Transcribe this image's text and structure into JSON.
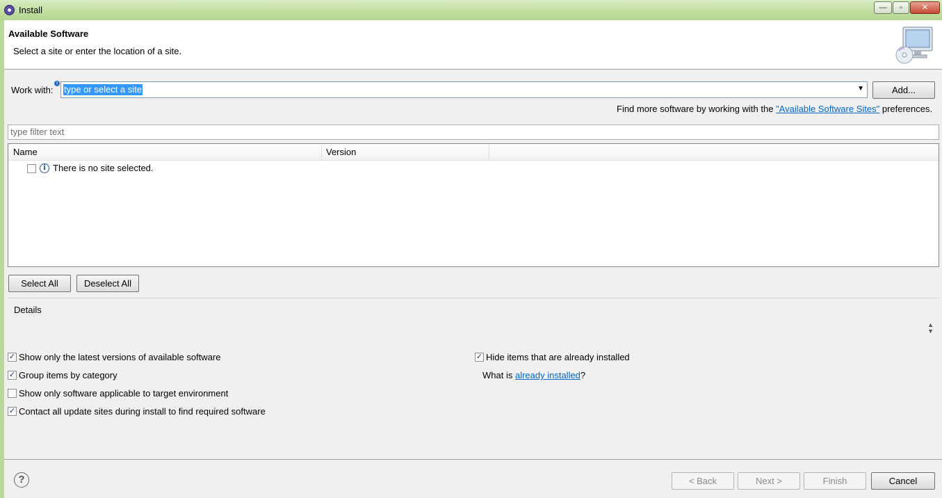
{
  "window": {
    "title": "Install",
    "controls": [
      "minimize",
      "maximize",
      "close"
    ]
  },
  "header": {
    "title": "Available Software",
    "description": "Select a site or enter the location of a site."
  },
  "work_with": {
    "label": "Work with:",
    "value": "type or select a site",
    "add_button": "Add...",
    "find_more_prefix": "Find more software by working with the ",
    "find_more_link": "\"Available Software Sites\"",
    "find_more_suffix": " preferences."
  },
  "filter": {
    "placeholder": "type filter text"
  },
  "table": {
    "columns": [
      "Name",
      "Version"
    ],
    "rows": [
      {
        "checked": false,
        "icon": "info-icon",
        "text": "There is no site selected."
      }
    ]
  },
  "buttons": {
    "select_all": "Select All",
    "deselect_all": "Deselect All",
    "back": "< Back",
    "next": "Next >",
    "finish": "Finish",
    "cancel": "Cancel"
  },
  "details": {
    "label": "Details"
  },
  "options": {
    "left": [
      {
        "label": "Show only the latest versions of available software",
        "checked": true
      },
      {
        "label": "Group items by category",
        "checked": true
      },
      {
        "label": "Show only software applicable to target environment",
        "checked": false
      },
      {
        "label": "Contact all update sites during install to find required software",
        "checked": true
      }
    ],
    "right": [
      {
        "label": "Hide items that are already installed",
        "checked": true
      }
    ],
    "what_is_prefix": "What is ",
    "what_is_link": "already installed",
    "what_is_suffix": "?"
  }
}
